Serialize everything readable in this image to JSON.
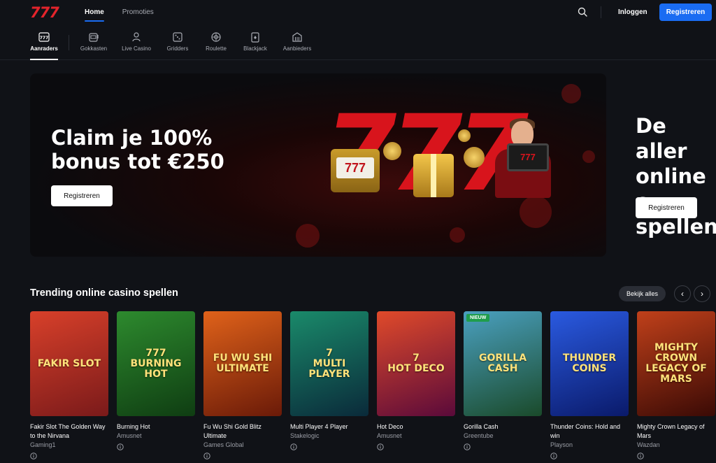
{
  "header": {
    "logo_text": "777",
    "nav": [
      {
        "label": "Home",
        "active": true
      },
      {
        "label": "Promoties",
        "active": false
      }
    ],
    "login_label": "Inloggen",
    "register_label": "Registreren"
  },
  "categories": [
    {
      "label": "Aanraders",
      "icon": "777-badge-icon",
      "active": true
    },
    {
      "label": "Gokkasten",
      "icon": "slot-machine-icon"
    },
    {
      "label": "Live Casino",
      "icon": "dealer-icon"
    },
    {
      "label": "Gridders",
      "icon": "dice-icon"
    },
    {
      "label": "Roulette",
      "icon": "roulette-icon"
    },
    {
      "label": "Blackjack",
      "icon": "cards-icon"
    },
    {
      "label": "Aanbieders",
      "icon": "building-icon"
    }
  ],
  "banners": [
    {
      "title": "Claim je 100%\nbonus tot €250",
      "button": "Registreren",
      "art_text": "777",
      "slot_text": "777"
    },
    {
      "title": "De aller\nonline c\nspellen",
      "button": "Registreren"
    }
  ],
  "trending": {
    "title": "Trending online casino spellen",
    "see_all": "Bekijk alles",
    "prev": "‹",
    "next": "›",
    "games": [
      {
        "name": "Fakir Slot The Golden Way to the Nirvana",
        "provider": "Gaming1",
        "art": "FAKIR SLOT",
        "colors": [
          "#d8402a",
          "#7a1a1a"
        ]
      },
      {
        "name": "Burning Hot",
        "provider": "Amusnet",
        "art": "777\nBURNING HOT",
        "colors": [
          "#2d8a2e",
          "#0f3d12"
        ]
      },
      {
        "name": "Fu Wu Shi Gold Blitz Ultimate",
        "provider": "Games Global",
        "art": "FU WU SHI\nULTIMATE",
        "colors": [
          "#e0621a",
          "#6a1a08"
        ]
      },
      {
        "name": "Multi Player 4 Player",
        "provider": "Stakelogic",
        "art": "7\nMULTI\nPLAYER",
        "colors": [
          "#1a8a6a",
          "#0a2a3a"
        ]
      },
      {
        "name": "Hot Deco",
        "provider": "Amusnet",
        "art": "7\nHOT DECO",
        "colors": [
          "#e04a2a",
          "#5a0a3a"
        ]
      },
      {
        "name": "Gorilla Cash",
        "provider": "Greentube",
        "art": "GORILLA\nCASH",
        "colors": [
          "#4aa0c0",
          "#1a4a2a"
        ],
        "badge": "NIEUW"
      },
      {
        "name": "Thunder Coins: Hold and win",
        "provider": "Playson",
        "art": "THUNDER\nCOINS",
        "colors": [
          "#2a5ae0",
          "#0a1a6a"
        ]
      },
      {
        "name": "Mighty Crown Legacy of Mars",
        "provider": "Wazdan",
        "art": "MIGHTY CROWN\nLEGACY OF MARS",
        "colors": [
          "#c0401a",
          "#3a0a05"
        ]
      }
    ]
  },
  "colors": {
    "accent": "#1a6cf2",
    "brand": "#e3242b",
    "background": "#101217"
  }
}
